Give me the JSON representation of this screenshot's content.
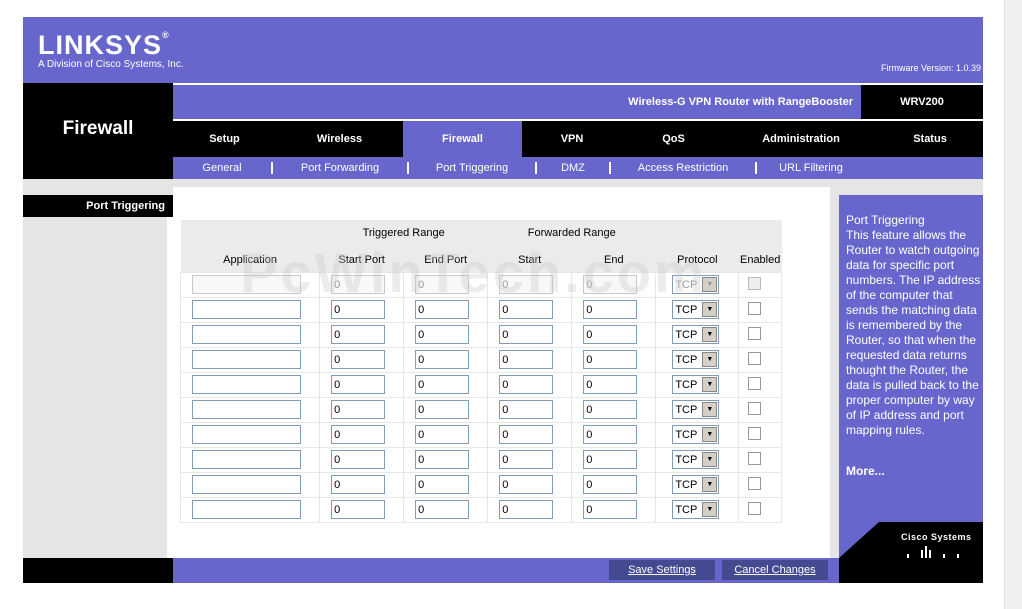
{
  "header": {
    "brand": "Linksys",
    "tagline": "A Division of Cisco Systems, Inc.",
    "firmware": "Firmware Version: 1.0.39",
    "section_title": "Firewall",
    "product_name": "Wireless-G VPN Router with RangeBooster",
    "model": "WRV200"
  },
  "tabs": [
    {
      "label": "Setup",
      "active": false
    },
    {
      "label": "Wireless",
      "active": false
    },
    {
      "label": "Firewall",
      "active": true
    },
    {
      "label": "VPN",
      "active": false
    },
    {
      "label": "QoS",
      "active": false
    },
    {
      "label": "Administration",
      "active": false
    },
    {
      "label": "Status",
      "active": false
    }
  ],
  "subtabs": [
    "General",
    "Port Forwarding",
    "Port Triggering",
    "DMZ",
    "Access Restriction",
    "URL Filtering"
  ],
  "sidebar": {
    "section": "Port Triggering"
  },
  "table": {
    "group_triggered": "Triggered Range",
    "group_forwarded": "Forwarded Range",
    "columns": [
      "Application",
      "Start Port",
      "End Port",
      "Start",
      "End",
      "Protocol",
      "Enabled"
    ],
    "rows": [
      {
        "application": "",
        "trig_start": "0",
        "trig_end": "0",
        "fwd_start": "0",
        "fwd_end": "0",
        "protocol": "TCP",
        "enabled": false,
        "disabled_row": true
      },
      {
        "application": "",
        "trig_start": "0",
        "trig_end": "0",
        "fwd_start": "0",
        "fwd_end": "0",
        "protocol": "TCP",
        "enabled": false,
        "disabled_row": false
      },
      {
        "application": "",
        "trig_start": "0",
        "trig_end": "0",
        "fwd_start": "0",
        "fwd_end": "0",
        "protocol": "TCP",
        "enabled": false,
        "disabled_row": false
      },
      {
        "application": "",
        "trig_start": "0",
        "trig_end": "0",
        "fwd_start": "0",
        "fwd_end": "0",
        "protocol": "TCP",
        "enabled": false,
        "disabled_row": false
      },
      {
        "application": "",
        "trig_start": "0",
        "trig_end": "0",
        "fwd_start": "0",
        "fwd_end": "0",
        "protocol": "TCP",
        "enabled": false,
        "disabled_row": false
      },
      {
        "application": "",
        "trig_start": "0",
        "trig_end": "0",
        "fwd_start": "0",
        "fwd_end": "0",
        "protocol": "TCP",
        "enabled": false,
        "disabled_row": false
      },
      {
        "application": "",
        "trig_start": "0",
        "trig_end": "0",
        "fwd_start": "0",
        "fwd_end": "0",
        "protocol": "TCP",
        "enabled": false,
        "disabled_row": false
      },
      {
        "application": "",
        "trig_start": "0",
        "trig_end": "0",
        "fwd_start": "0",
        "fwd_end": "0",
        "protocol": "TCP",
        "enabled": false,
        "disabled_row": false
      },
      {
        "application": "",
        "trig_start": "0",
        "trig_end": "0",
        "fwd_start": "0",
        "fwd_end": "0",
        "protocol": "TCP",
        "enabled": false,
        "disabled_row": false
      },
      {
        "application": "",
        "trig_start": "0",
        "trig_end": "0",
        "fwd_start": "0",
        "fwd_end": "0",
        "protocol": "TCP",
        "enabled": false,
        "disabled_row": false
      }
    ]
  },
  "help": {
    "title": "Port Triggering",
    "text": "This feature allows the Router to watch outgoing data for specific port numbers. The IP address of the computer that sends the matching data is remembered by the Router, so that when the requested data returns thought the Router, the data is pulled back to the proper computer by way of IP address and port mapping rules.",
    "more": "More..."
  },
  "cisco": "Cisco Systems",
  "watermark": "PcWinTech.com",
  "buttons": {
    "save": "Save Settings",
    "cancel": "Cancel Changes"
  },
  "colors": {
    "accent": "#6666cc",
    "dark": "#000000",
    "button": "#434a8f",
    "panel": "#e5e5e5"
  }
}
